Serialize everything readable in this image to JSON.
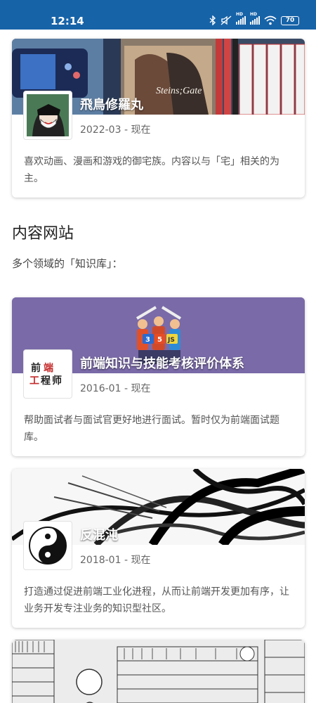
{
  "status_bar": {
    "time": "12:14",
    "battery": "70",
    "network_label": "HD",
    "icons": [
      "bluetooth-icon",
      "mute-icon",
      "signal-icon",
      "signal-icon",
      "wifi-icon",
      "battery-icon"
    ]
  },
  "cards": [
    {
      "title": "飛鳥修羅丸",
      "date": "2022-03 - 现在",
      "description": "喜欢动画、漫画和游戏的御宅族。内容以与「宅」相关的为主。",
      "banner_image": "shelf-of-games-and-blu-rays-photo",
      "banner_text": "Steins;Gate",
      "avatar_image": "masked-character-avatar"
    },
    {
      "title": "前端知识与技能考核评价体系",
      "date": "2016-01 - 现在",
      "description": "帮助面试者与面试官更好地进行面试。暂时仅为前端面试题库。",
      "banner_image": "html-css-js-characters-illustration",
      "banner_color": "#7a6aa8",
      "badge_labels": [
        "3",
        "5",
        "JS"
      ],
      "avatar_text": [
        "前",
        "端",
        "工",
        "程",
        "师"
      ]
    },
    {
      "title": "反混沌",
      "date": "2018-01 - 现在",
      "description": "打造通过促进前端工业化进程，从而让前端开发更加有序，让业务开发专注业务的知识型社区。",
      "banner_image": "ink-chaos-sketch",
      "avatar_image": "yin-yang-icon"
    },
    {
      "banner_image": "manga-library-sketch"
    }
  ],
  "section": {
    "title": "内容网站",
    "subtitle": "多个领域的「知识库」："
  }
}
